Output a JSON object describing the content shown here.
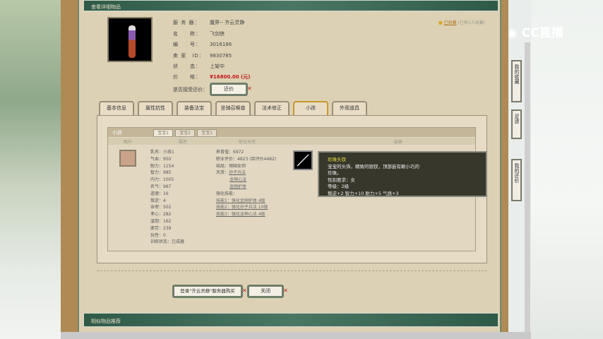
{
  "header": {
    "title": "查看详细物品"
  },
  "info": {
    "server_label": "服 务 器：",
    "server": "魔界-- 齐云灵静",
    "name_label": "名　　称：",
    "name": "飞剑侠",
    "id_label": "编　　号：",
    "id": "3016186",
    "seller_label": "卖 家　ID：",
    "seller": "9830785",
    "status_label": "状　　态：",
    "status": "上架中",
    "price_label": "价　　格：",
    "price": "¥16800.00 (元)",
    "bargain_label": "是否接受还价：",
    "bargain_button": "还价"
  },
  "favorite": {
    "link": "已收藏",
    "count": "(已有1人收藏)"
  },
  "tabs": [
    "基本信息",
    "属性抗性",
    "装备法宝",
    "坐骑召唤兽",
    "法术修正",
    "小孩",
    "外观道具"
  ],
  "child": {
    "section": "小孩",
    "subtabs": [
      "宝宝1",
      "宝宝2",
      "宝宝1"
    ],
    "columns": [
      "图片",
      "属性",
      "职业天资",
      "装备"
    ],
    "stats": [
      "乳名：小孩1",
      "气血：950",
      "耐力：1154",
      "智力：985",
      "内力：1005",
      "名气：967",
      "道德：16",
      "叛逆：4",
      "亲密：502",
      "孝心：282",
      "温饱：162",
      "疲劳：239",
      "玩性：0",
      "训练状态：已成器"
    ],
    "career": {
      "total": "养育值：6972",
      "score": "职业评价：4823 (目评价4482)",
      "ending": "结局：倾国女帅",
      "talent_label": "天资：",
      "talents": [
        "孙子兵法",
        "龙神心法",
        "金刚护体"
      ],
      "skill_label": "强化技能：",
      "skills": [
        "技能1：强化金刚护体 4级",
        "技能2：强化孙子兵法 10级",
        "技能3：强化龙神心法 4级"
      ]
    }
  },
  "tooltip": {
    "title": "珍珠头钗",
    "desc": "宝宝的头饰，精致的银钗，顶部嵌有颗小巧的珍珠。",
    "gender": "性别要求：女",
    "level": "等级：2级",
    "attrs": "叛逆+2 智力+10 耐力+5 气质+3"
  },
  "buttons": {
    "login": "登录\"齐云灵静\"服务器购买",
    "close": "关闭"
  },
  "related": {
    "title": "相似物品推荐"
  },
  "sidebar": [
    "我的收藏",
    "足迹",
    "我的还价"
  ],
  "logo": "CC直播"
}
